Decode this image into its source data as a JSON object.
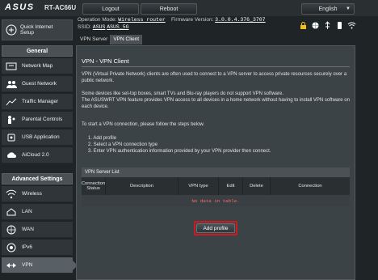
{
  "header": {
    "brand": "ASUS",
    "model": "RT-AC66U",
    "logout_label": "Logout",
    "reboot_label": "Reboot",
    "language": "English"
  },
  "info": {
    "operation_mode_label": "Operation Mode:",
    "operation_mode_value": "Wireless router",
    "firmware_label": "Firmware Version:",
    "firmware_value": "3.0.0.4.376_3707",
    "ssid_label": "SSID:",
    "ssid_values": [
      "ASUS",
      "ASUS_5G"
    ]
  },
  "status_icons": [
    "lock-icon",
    "globe-icon",
    "usb-icon",
    "phone-icon",
    "wifi-icon"
  ],
  "tabs": [
    {
      "label": "VPN Server",
      "active": false
    },
    {
      "label": "VPN Client",
      "active": true
    }
  ],
  "sidebar": {
    "quick_setup": "Quick Internet\nSetup",
    "general_label": "General",
    "general_items": [
      {
        "label": "Network Map",
        "icon": "network-map-icon"
      },
      {
        "label": "Guest Network",
        "icon": "guest-network-icon"
      },
      {
        "label": "Traffic Manager",
        "icon": "traffic-manager-icon"
      },
      {
        "label": "Parental Controls",
        "icon": "parental-controls-icon"
      },
      {
        "label": "USB Application",
        "icon": "usb-application-icon"
      },
      {
        "label": "AiCloud 2.0",
        "icon": "aicloud-icon"
      }
    ],
    "advanced_label": "Advanced Settings",
    "advanced_items": [
      {
        "label": "Wireless",
        "icon": "wireless-icon"
      },
      {
        "label": "LAN",
        "icon": "lan-icon"
      },
      {
        "label": "WAN",
        "icon": "wan-icon"
      },
      {
        "label": "IPv6",
        "icon": "ipv6-icon"
      },
      {
        "label": "VPN",
        "icon": "vpn-icon",
        "active": true
      }
    ]
  },
  "content": {
    "title": "VPN - VPN Client",
    "para1": "VPN (Virtual Private Network) clients are often used to connect to a VPN server to access private resources securely over a public network.",
    "para2": "Some devices like set-top boxes, smart TVs and Blu-ray players do not support VPN software.",
    "para3": "The ASUSWRT VPN feature provides VPN access to all devices in a home network without having to install VPN software on each device.",
    "para4": "To start a VPN connection, please follow the steps below.",
    "steps": [
      "1. Add profile",
      "2. Select a VPN connection type",
      "3. Enter VPN authentication information provided by your VPN provider then connect."
    ],
    "table": {
      "title": "VPN Server List",
      "columns": [
        "Connection Status",
        "Description",
        "VPN type",
        "Edit",
        "Delete",
        "Connection"
      ],
      "empty_text": "No data in table."
    },
    "add_profile_label": "Add profile"
  },
  "colors": {
    "background": "#1f2426",
    "panel": "#3c4346",
    "highlight_border": "#d01820",
    "empty_text": "#ff6b6b"
  }
}
